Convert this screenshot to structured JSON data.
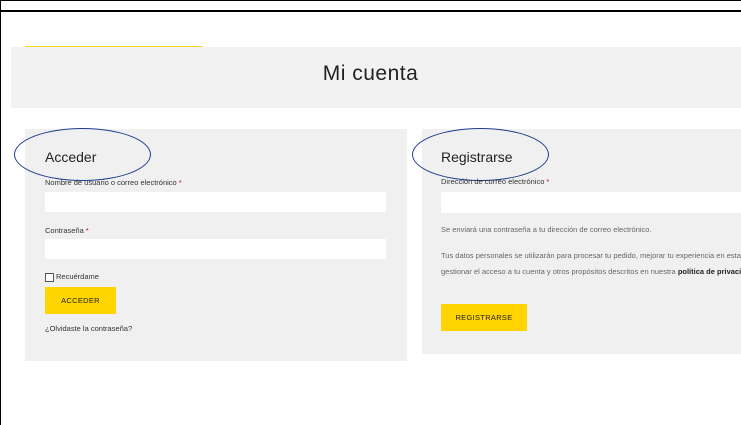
{
  "page": {
    "title": "Mi cuenta"
  },
  "login": {
    "heading": "Acceder",
    "username_label": "Nombre de usuario o correo electrónico",
    "password_label": "Contraseña",
    "required_marker": "*",
    "remember_label": "Recuérdame",
    "submit_label": "ACCEDER",
    "forgot_link": "¿Olvidaste la contraseña?"
  },
  "register": {
    "heading": "Registrarse",
    "email_label": "Dirección de correo electrónico",
    "required_marker": "*",
    "password_note": "Se enviará una contraseña a tu dirección de correo electrónico.",
    "privacy_text_before": "Tus datos personales se utilizarán para procesar tu pedido, mejorar tu experiencia en esta web, gestionar el acceso a tu cuenta y otros propósitos descritos en nuestra ",
    "privacy_link": "política de privacidad",
    "privacy_text_after": ".",
    "submit_label": "REGISTRARSE"
  },
  "colors": {
    "accent": "#ffd400",
    "panel_bg": "#f0f0f0",
    "required": "#d0021b",
    "annotation_oval": "#1f3d8f"
  }
}
